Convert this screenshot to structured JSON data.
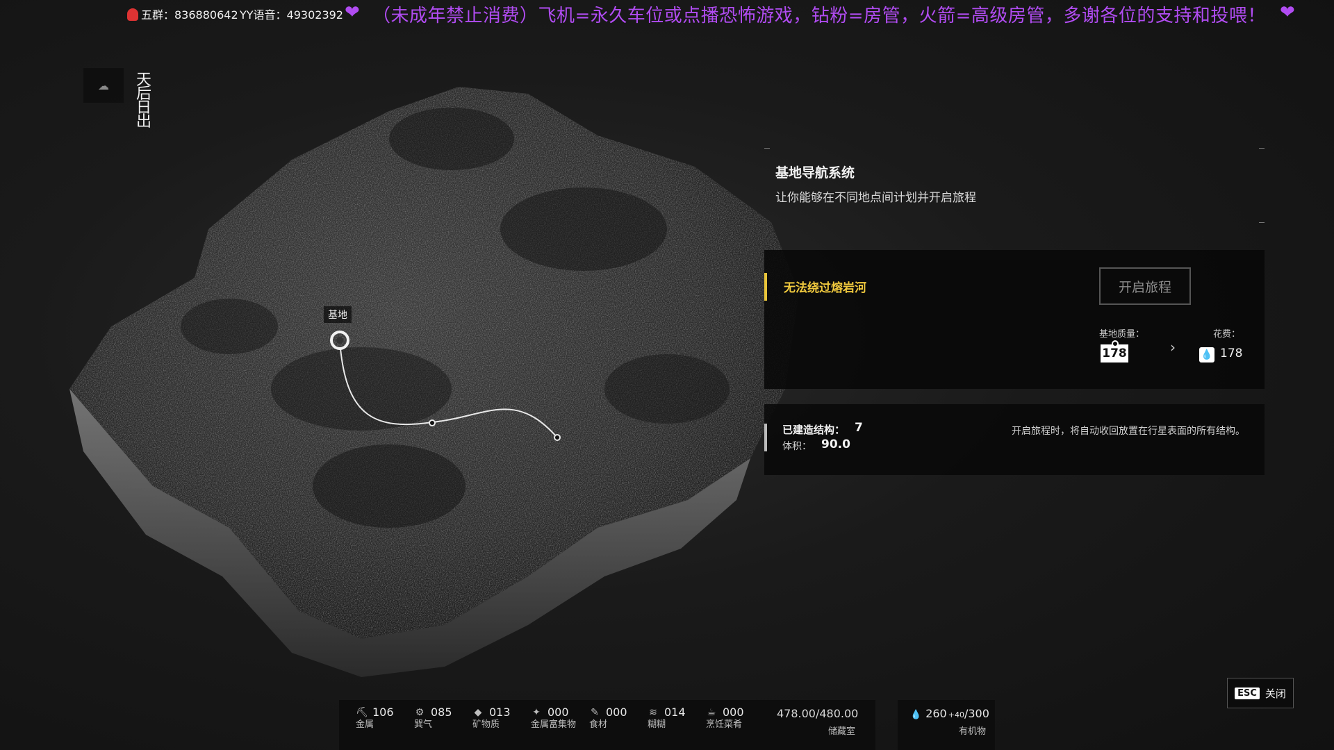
{
  "ticker": {
    "qq_group": "五群：836880642",
    "yy_voice": "YY语音：49302392",
    "heart": "❤",
    "message": "（未成年禁止消费）飞机=永久车位或点播恐怖游戏，钻粉=房管，火箭=高级房管，多谢各位的支持和投喂！"
  },
  "weather": {
    "icon": "cloud-sun-icon",
    "label": "天后日出"
  },
  "map": {
    "base_label": "基地"
  },
  "navigation": {
    "title": "基地导航系统",
    "description": "让你能够在不同地点间计划并开启旅程"
  },
  "route": {
    "warning": "无法绕过熔岩河",
    "warning_color": "#f0c93e",
    "start_button": "开启旅程",
    "mass_label": "基地质量：",
    "mass_value": "178",
    "arrow": "›",
    "cost_label": "花费：",
    "cost_value": "178"
  },
  "structures": {
    "built_label": "已建造结构：",
    "built_value": "7",
    "volume_label": "体积：",
    "volume_value": "90.0",
    "note": "开启旅程时，将自动收回放置在行星表面的所有结构。"
  },
  "close": {
    "key": "ESC",
    "label": "关闭"
  },
  "resources": [
    {
      "icon": "metal-icon",
      "glyph": "⛏",
      "value": "106",
      "name": "金属"
    },
    {
      "icon": "gear-icon",
      "glyph": "⚙",
      "value": "085",
      "name": "巽气"
    },
    {
      "icon": "mineral-icon",
      "glyph": "◆",
      "value": "013",
      "name": "矿物质"
    },
    {
      "icon": "metal-ore-icon",
      "glyph": "✦",
      "value": "000",
      "name": "金属富集物"
    },
    {
      "icon": "food-icon",
      "glyph": "✎",
      "value": "000",
      "name": "食材"
    },
    {
      "icon": "paste-icon",
      "glyph": "≋",
      "value": "014",
      "name": "糊糊"
    },
    {
      "icon": "dish-icon",
      "glyph": "☕",
      "value": "000",
      "name": "烹饪菜肴"
    }
  ],
  "storage": {
    "value": "478.00/480.00",
    "name": "储藏室"
  },
  "organic": {
    "value": "260",
    "bonus": "+40",
    "max": "/300",
    "name": "有机物"
  }
}
